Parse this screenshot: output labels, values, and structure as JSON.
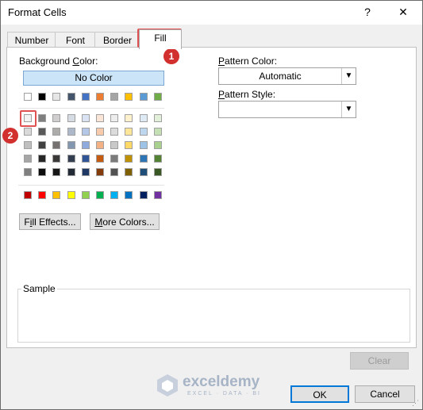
{
  "window": {
    "title": "Format Cells",
    "help_label": "?",
    "close_label": "✕"
  },
  "tabs": [
    "Number",
    "Font",
    "Border",
    "Fill"
  ],
  "active_tab": "Fill",
  "fill": {
    "background_color_label": "Background Color:",
    "no_color_label": "No Color",
    "theme_row": [
      "#ffffff",
      "#000000",
      "#e7e6e6",
      "#44546a",
      "#4472c4",
      "#ed7d31",
      "#a5a5a5",
      "#ffc000",
      "#5b9bd5",
      "#70ad47"
    ],
    "tint_rows": [
      [
        "#f2f2f2",
        "#7f7f7f",
        "#d0cece",
        "#d6dce4",
        "#dae3f3",
        "#fbe5d6",
        "#ededed",
        "#fff2cc",
        "#deebf7",
        "#e2f0d9"
      ],
      [
        "#d9d9d9",
        "#595959",
        "#aeabab",
        "#adb9ca",
        "#b4c7e7",
        "#f8cbad",
        "#dbdbdb",
        "#ffe699",
        "#bdd7ee",
        "#c5e0b4"
      ],
      [
        "#bfbfbf",
        "#404040",
        "#757171",
        "#8497b0",
        "#8faadc",
        "#f4b183",
        "#c9c9c9",
        "#ffd966",
        "#9dc3e6",
        "#a9d18e"
      ],
      [
        "#a6a6a6",
        "#262626",
        "#3b3838",
        "#333f50",
        "#2f5597",
        "#c55a11",
        "#7b7b7b",
        "#bf9000",
        "#2e75b6",
        "#548235"
      ],
      [
        "#7f7f7f",
        "#0d0d0d",
        "#171717",
        "#222a35",
        "#203864",
        "#843c0c",
        "#525252",
        "#7f6000",
        "#1f4e79",
        "#385723"
      ]
    ],
    "standard_row": [
      "#c00000",
      "#ff0000",
      "#ffc000",
      "#ffff00",
      "#92d050",
      "#00b050",
      "#00b0f0",
      "#0070c0",
      "#002060",
      "#7030a0"
    ],
    "fill_effects_label": "Fill Effects...",
    "more_colors_label": "More Colors...",
    "pattern_color_label": "Pattern Color:",
    "pattern_color_value": "Automatic",
    "pattern_style_label": "Pattern Style:",
    "pattern_style_value": "",
    "sample_label": "Sample"
  },
  "buttons": {
    "clear": "Clear",
    "ok": "OK",
    "cancel": "Cancel"
  },
  "callouts": [
    "1",
    "2"
  ],
  "watermark": {
    "name": "exceldemy",
    "tagline": "EXCEL · DATA · BI"
  }
}
